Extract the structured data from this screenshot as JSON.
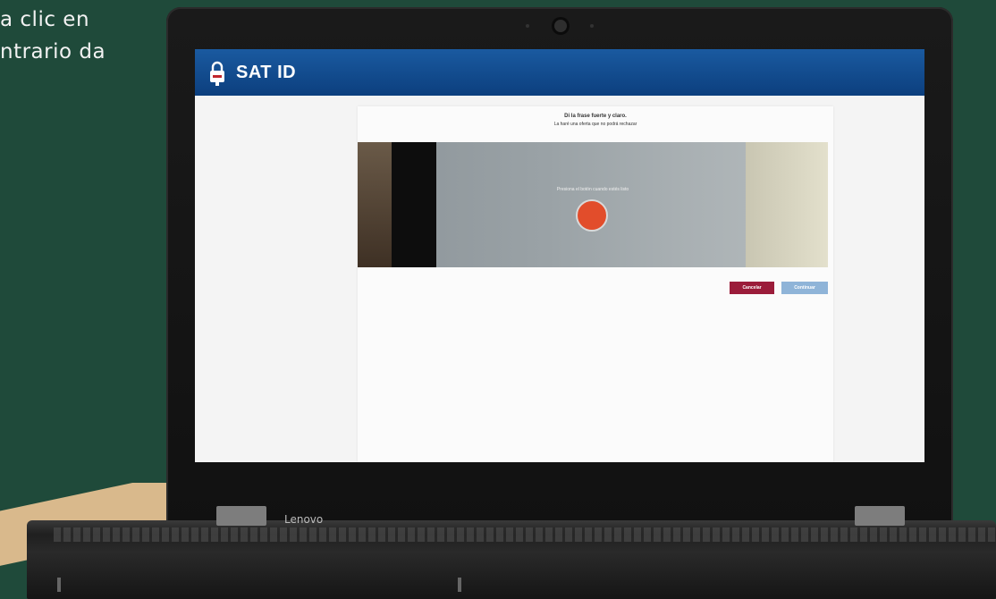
{
  "background": {
    "text_lines": [
      "a clic en",
      "ntrario da"
    ],
    "color": "#1f4a3a",
    "stripe_color": "#d9b98c"
  },
  "laptop": {
    "brand": "Lenovo"
  },
  "app": {
    "title": "SAT ID",
    "header_color": "#0c3f7e",
    "icon": "lock-icon"
  },
  "capture": {
    "instruction": "Di la frase fuerte y claro.",
    "sub_instruction": "La haré una oferta que no podrá rechazar",
    "video_prompt": "Presiona el botón cuando estés listo",
    "record_button_color": "#e24d2b"
  },
  "buttons": {
    "cancel": "Cancelar",
    "continue": "Continuar",
    "cancel_color": "#9b1c3a",
    "continue_color": "#8fb4d8"
  }
}
